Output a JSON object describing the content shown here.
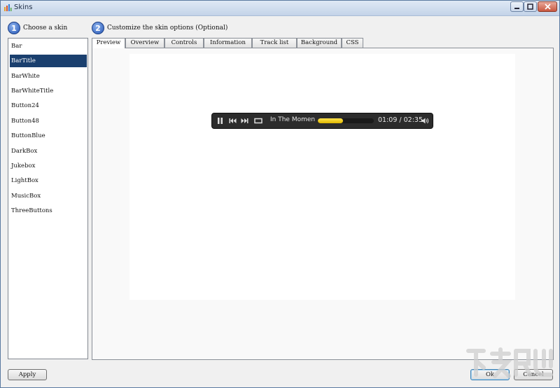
{
  "window": {
    "title": "Skins"
  },
  "steps": [
    {
      "number": "1",
      "label": "Choose a skin"
    },
    {
      "number": "2",
      "label": "Customize the skin options (Optional)"
    }
  ],
  "skins": {
    "selected_index": 1,
    "items": [
      "Bar",
      "BarTitle",
      "BarWhite",
      "BarWhiteTitle",
      "Button24",
      "Button48",
      "ButtonBlue",
      "DarkBox",
      "Jukebox",
      "LightBox",
      "MusicBox",
      "ThreeButtons"
    ]
  },
  "tabs": {
    "active_index": 0,
    "items": [
      "Preview",
      "Overview",
      "Controls",
      "Information",
      "Track list",
      "Background",
      "CSS"
    ]
  },
  "player": {
    "track_title": "In The Momen",
    "time": "01:09 / 02:35",
    "progress": 0.45
  },
  "buttons": {
    "apply": "Apply",
    "ok": "Ok",
    "cancel": "Cancel"
  },
  "colors": {
    "selection": "#1a3f6e",
    "progress": "#f2cc00"
  }
}
